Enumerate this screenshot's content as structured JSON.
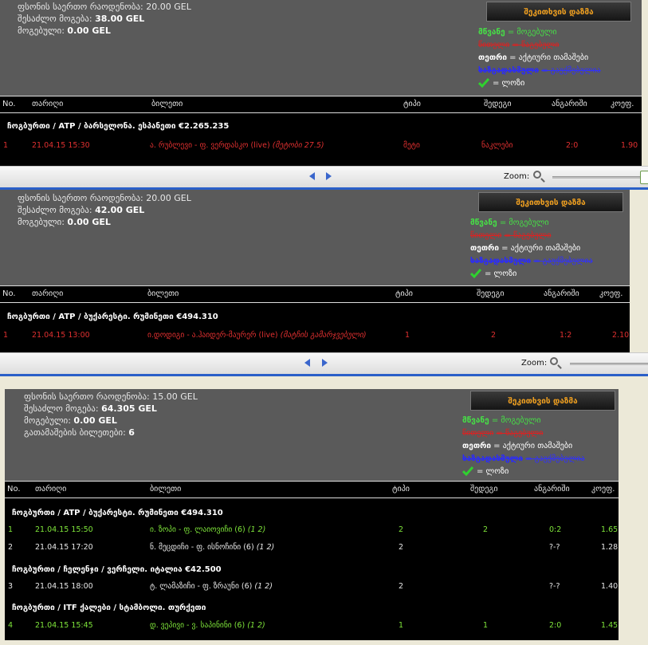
{
  "panels": [
    {
      "summary": {
        "total_bet_label": "ფსონის საერთო რაოდენობა:",
        "total_bet_value": "20.00 GEL",
        "max_win_label": "შესაძლო მოგება:",
        "max_win_value": "38.00 GEL",
        "won_label": "მოგებული:",
        "won_value": "0.00 GEL"
      },
      "bet_button": "შეკითხვის დაზმა",
      "legend": {
        "green_key": "მწვანე",
        "green_desc": "= მოგებული",
        "red_key": "წითელი",
        "red_desc": "= წაგებული",
        "white_key": "თეთრი",
        "white_desc": "= აქტიური თამაშები",
        "blue_key": "ხაზგადასმული",
        "blue_desc": "= გაუქმებულია",
        "check_desc": "= ლოზი"
      },
      "headers": [
        "No.",
        "თარიღი",
        "ბილეთი",
        "ტიპი",
        "შედეგი",
        "ანგარიში",
        "კოეფ."
      ],
      "groups": [
        {
          "title": "ჩოგბურთი / ATP / ბარსელონა. ესპანეთი €2.265.235",
          "rows": [
            {
              "no": "1",
              "date": "21.04.15 15:30",
              "ticket": "ა. რუბლევი - ფ. ვერდასკო (live)",
              "ticket_note": "(მეტობი 27.5)",
              "type": "მეტი",
              "result": "ნაკლები",
              "score": "2:0",
              "odds": "1.90",
              "status": "red"
            }
          ]
        }
      ]
    },
    {
      "summary": {
        "total_bet_label": "ფსონის საერთო რაოდენობა:",
        "total_bet_value": "20.00 GEL",
        "max_win_label": "შესაძლო მოგება:",
        "max_win_value": "42.00 GEL",
        "won_label": "მოგებული:",
        "won_value": "0.00 GEL"
      },
      "bet_button": "შეკითხვის დაზმა",
      "legend": {
        "green_key": "მწვანე",
        "green_desc": "= მოგებული",
        "red_key": "წითელი",
        "red_desc": "= წაგებული",
        "white_key": "თეთრი",
        "white_desc": "= აქტიური თამაშები",
        "blue_key": "ხაზგადასმული",
        "blue_desc": "= გაუქმებულია",
        "check_desc": "= ლოზი"
      },
      "headers": [
        "No.",
        "თარიღი",
        "ბილეთი",
        "ტიპი",
        "შედეგი",
        "ანგარიში",
        "კოეფ."
      ],
      "groups": [
        {
          "title": "ჩოგბურთი / ATP / ბუქარესტი. რუმინეთი €494.310",
          "rows": [
            {
              "no": "1",
              "date": "21.04.15 13:00",
              "ticket": "ი.დოდიგი - ა.ჰაიდერ-მაურერ (live)",
              "ticket_note": "(მატჩის გამარჯვებული)",
              "type": "1",
              "result": "2",
              "score": "1:2",
              "odds": "2.10",
              "status": "red"
            }
          ]
        }
      ]
    },
    {
      "summary": {
        "total_bet_label": "ფსონის საერთო რაოდენობა:",
        "total_bet_value": "15.00 GEL",
        "max_win_label": "შესაძლო მოგება:",
        "max_win_value": "64.305 GEL",
        "won_label": "მოგებული:",
        "won_value": "0.00 GEL",
        "remaining_label": "გათამაშების ბილეთები:",
        "remaining_value": "6"
      },
      "bet_button": "შეკითხვის დაზმა",
      "legend": {
        "green_key": "მწვანე",
        "green_desc": "= მოგებული",
        "red_key": "წითელი",
        "red_desc": "= წაგებული",
        "white_key": "თეთრი",
        "white_desc": "= აქტიური თამაშები",
        "blue_key": "ხაზგადასმული",
        "blue_desc": "= გაუქმებულია",
        "check_desc": "= ლოზი"
      },
      "headers": [
        "No.",
        "თარიღი",
        "ბილეთი",
        "ტიპი",
        "შედეგი",
        "ანგარიში",
        "კოეფ."
      ],
      "groups": [
        {
          "title": "ჩოგბურთი / ATP / ბუქარესტი. რუმინეთი €494.310",
          "rows": [
            {
              "no": "1",
              "date": "21.04.15 15:50",
              "ticket": "ი. ზოპი - ფ. ლაიოვიჩი (6)",
              "ticket_note": "(1 2)",
              "type": "2",
              "result": "2",
              "score": "0:2",
              "odds": "1.65",
              "status": "green"
            },
            {
              "no": "2",
              "date": "21.04.15 17:20",
              "ticket": "ნ. მეცდიჩი - ფ. ისნოჩინი (6)",
              "ticket_note": "(1 2)",
              "type": "2",
              "result": "",
              "score": "?-?",
              "odds": "1.28",
              "status": "white"
            }
          ]
        },
        {
          "title": "ჩოგბურთი / ჩელენჯი / ვერჩელი. იტალია €42.500",
          "rows": [
            {
              "no": "3",
              "date": "21.04.15 18:00",
              "ticket": "ტ. ლამაზიჩი - ფ. ზრაუნი (6)",
              "ticket_note": "(1 2)",
              "type": "2",
              "result": "",
              "score": "?-?",
              "odds": "1.40",
              "status": "white"
            }
          ]
        },
        {
          "title": "ჩოგბურთი / ITF ქალები / სტამბოლი. თურქეთი",
          "rows": [
            {
              "no": "4",
              "date": "21.04.15 15:45",
              "ticket": "დ. ვეპივი - ვ. საპინინი (6)",
              "ticket_note": "(1 2)",
              "type": "1",
              "result": "1",
              "score": "2:0",
              "odds": "1.45",
              "status": "green"
            }
          ]
        }
      ]
    }
  ],
  "zoombar": {
    "label": "Zoom:"
  }
}
